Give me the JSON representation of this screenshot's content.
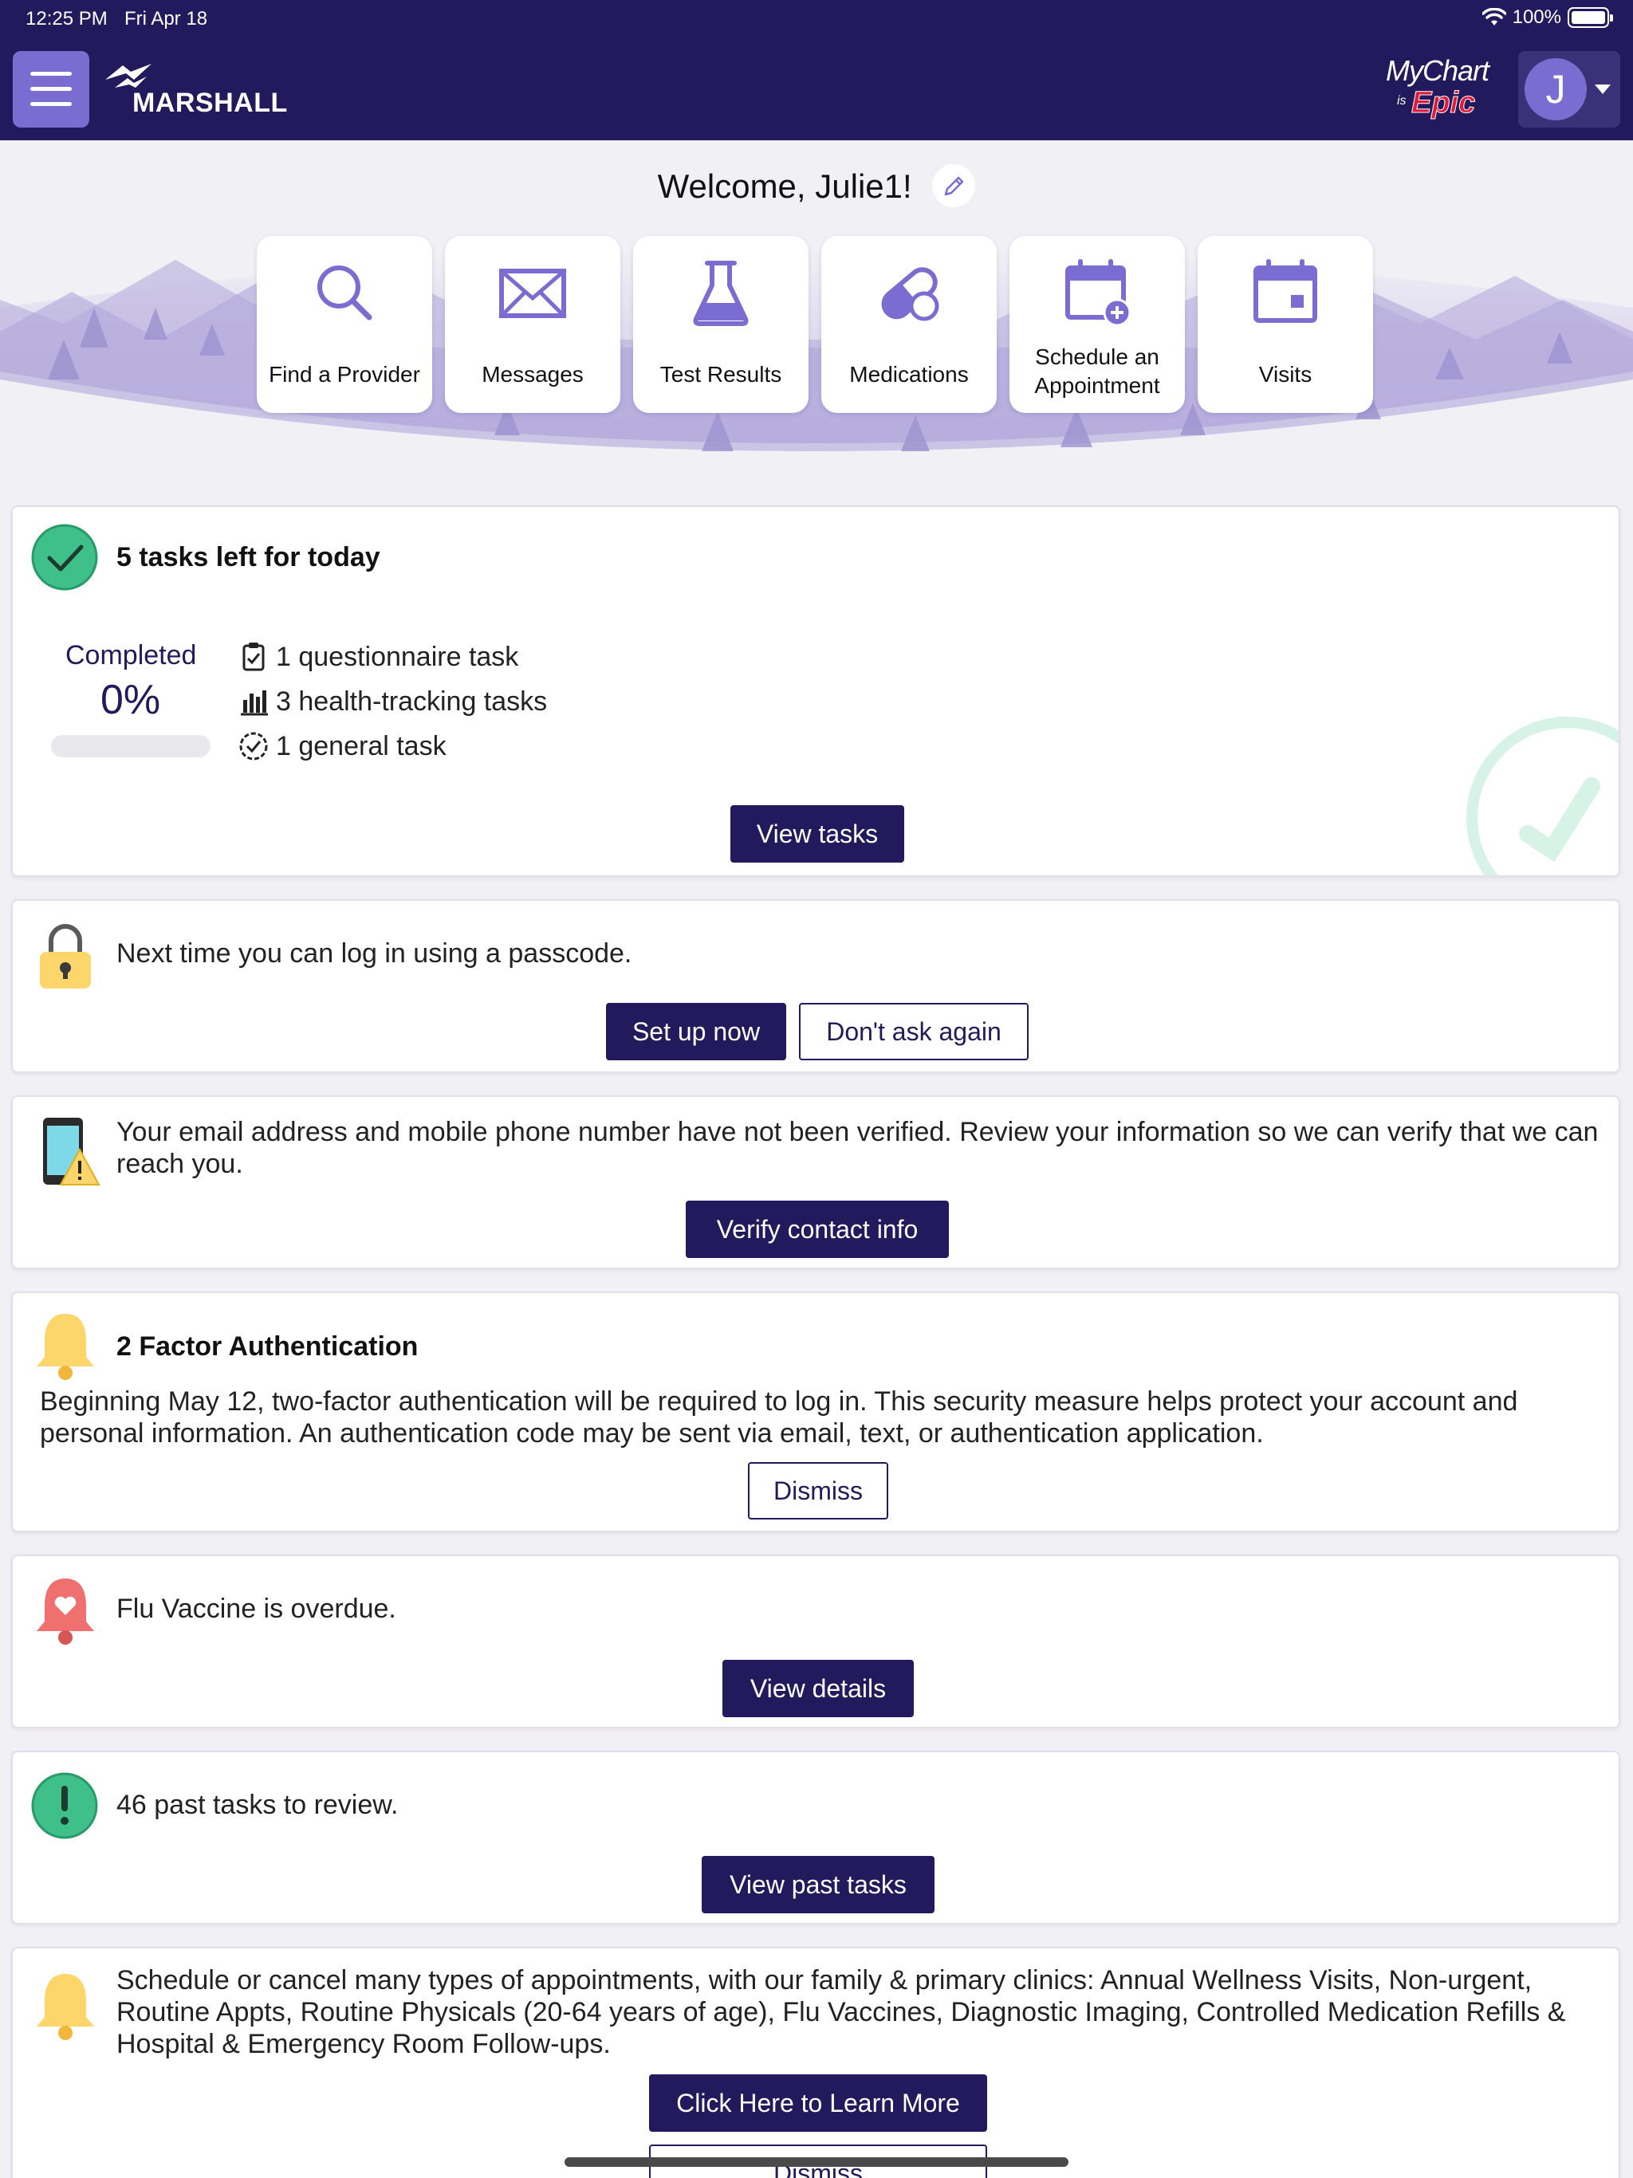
{
  "status_bar": {
    "time": "12:25 PM",
    "date": "Fri Apr 18",
    "battery": "100%"
  },
  "header": {
    "brand": "MARSHALL",
    "mychart": {
      "line1": "MyChart",
      "is": "is",
      "epic": "Epic"
    },
    "avatar_initial": "J"
  },
  "banner": {
    "welcome": "Welcome, Julie1!",
    "quick_actions": [
      {
        "label": "Find a Provider",
        "icon": "search-icon"
      },
      {
        "label": "Messages",
        "icon": "envelope-icon"
      },
      {
        "label": "Test Results",
        "icon": "flask-icon"
      },
      {
        "label": "Medications",
        "icon": "pill-icon"
      },
      {
        "label": "Schedule an Appointment",
        "icon": "calendar-plus-icon"
      },
      {
        "label": "Visits",
        "icon": "calendar-icon"
      }
    ]
  },
  "tasks_card": {
    "title": "5 tasks left for today",
    "completed_label": "Completed",
    "completed_percent": "0%",
    "completed_fraction": 0,
    "items": [
      {
        "text": "1 questionnaire task",
        "icon": "clipboard-check-icon"
      },
      {
        "text": "3 health-tracking tasks",
        "icon": "bar-chart-icon"
      },
      {
        "text": "1 general task",
        "icon": "clock-check-icon"
      }
    ],
    "button": "View tasks"
  },
  "passcode_card": {
    "text": "Next time you can log in using a passcode.",
    "primary_button": "Set up now",
    "secondary_button": "Don't ask again"
  },
  "verify_card": {
    "text": "Your email address and mobile phone number have not been verified. Review your information so we can verify that we can reach you.",
    "button": "Verify contact info"
  },
  "twofa_card": {
    "title": "2 Factor Authentication",
    "text": "Beginning May 12, two-factor authentication will be required to log in. This security measure helps protect your account and personal information. An authentication code may be sent via email, text, or authentication application.",
    "button": "Dismiss"
  },
  "flu_card": {
    "text": "Flu Vaccine is overdue.",
    "button": "View details"
  },
  "past_tasks_card": {
    "text": "46 past tasks to review.",
    "button": "View past tasks"
  },
  "schedule_card": {
    "text": "Schedule or cancel many types of appointments, with our family & primary clinics: Annual Wellness Visits, Non-urgent, Routine Appts, Routine Physicals (20-64 years of age), Flu Vaccines, Diagnostic Imaging, Controlled Medication Refills & Hospital & Emergency Room Follow-ups.",
    "primary_button": "Click Here to Learn More",
    "secondary_button": "Dismiss"
  },
  "colors": {
    "header": "#221a5c",
    "accent": "#7b6cd1",
    "button": "#221a5c",
    "success": "#3fbf8a",
    "warning": "#fcd56b",
    "alert": "#f07070"
  }
}
